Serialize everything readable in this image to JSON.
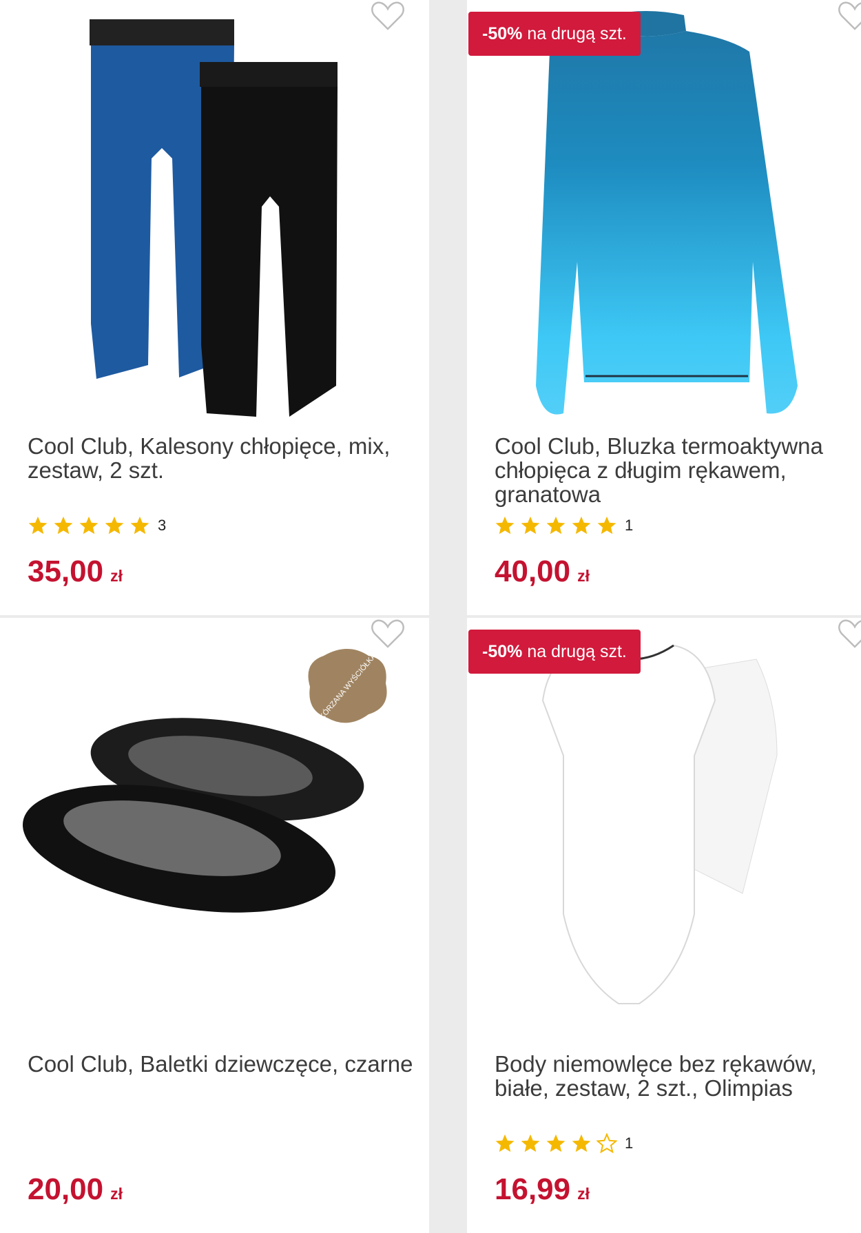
{
  "products": [
    {
      "name": "Cool Club, Kalesony chłopięce, mix, zestaw, 2 szt.",
      "rating_stars": 5,
      "rating_count": "3",
      "price": "35,00",
      "currency": "zł",
      "promo": null
    },
    {
      "name": "Cool Club, Bluzka termoaktywna chłopięca z długim rękawem, granatowa",
      "rating_stars": 5,
      "rating_count": "1",
      "price": "40,00",
      "currency": "zł",
      "promo": {
        "discount": "-50%",
        "text": "na drugą szt."
      }
    },
    {
      "name": "Cool Club, Baletki dziewczęce, czarne",
      "price": "20,00",
      "currency": "zł",
      "promo": null,
      "badge": "SKÓRZANA WYŚCIÓŁKA"
    },
    {
      "name": "Body niemowlęce bez rękawów, białe, zestaw, 2 szt., Olimpias",
      "rating_stars": 4,
      "rating_count": "1",
      "price": "16,99",
      "currency": "zł",
      "promo": {
        "discount": "-50%",
        "text": "na drugą szt."
      }
    }
  ],
  "colors": {
    "price": "#c41230",
    "promo_bg": "#d11a3c",
    "star": "#f5b800",
    "background": "#ebebeb"
  },
  "icons": [
    "heart-outline-icon",
    "star-icon",
    "leather-badge-icon"
  ]
}
